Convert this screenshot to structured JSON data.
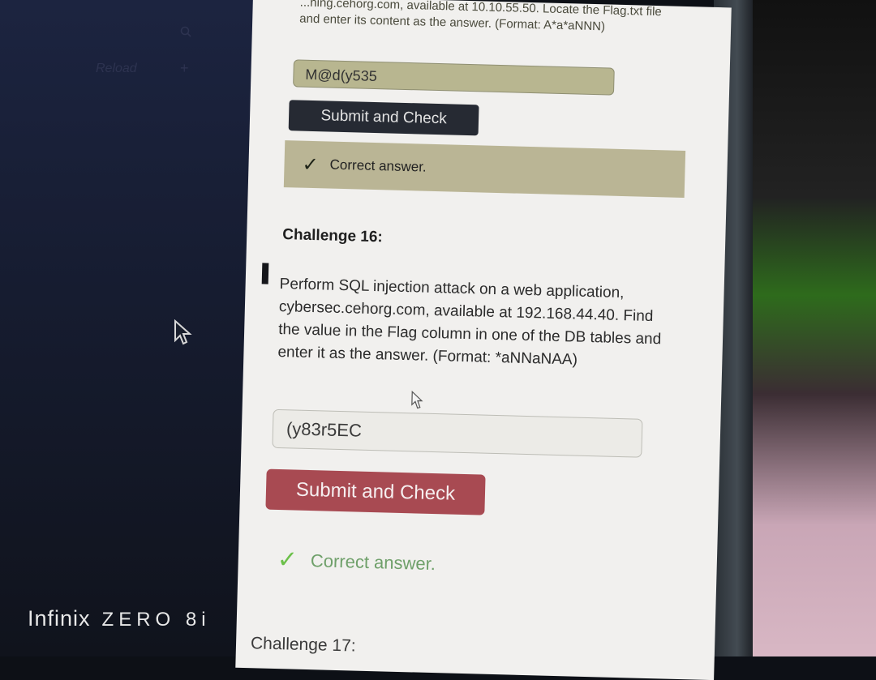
{
  "sidebar": {
    "reload_label": "Reload",
    "search_icon": "search-icon",
    "plus_icon": "plus-icon"
  },
  "previous_challenge": {
    "text": "...ning.cehorg.com, available at 10.10.55.50. Locate the Flag.txt file and enter its content as the answer. (Format: A*a*aNNN)",
    "answer_value": "M@d(y535",
    "submit_label": "Submit and Check",
    "feedback": "Correct answer."
  },
  "challenge16": {
    "title": "Challenge 16:",
    "description": "Perform SQL injection attack on a web application, cybersec.cehorg.com, available at 192.168.44.40. Find the value in the Flag column in one of the DB tables and enter it as the answer. (Format: *aNNaNAA)",
    "answer_value": "(y83r5EC",
    "submit_label": "Submit and Check",
    "feedback": "Correct answer."
  },
  "next_challenge": {
    "title": "Challenge 17:"
  },
  "device": {
    "brand": "Infinix",
    "model": "ZERO 8i"
  },
  "colors": {
    "submit_dark": "#262a33",
    "submit_red": "#a84a52",
    "feedback_bg": "#bab595",
    "check_green": "#6cc04a"
  }
}
